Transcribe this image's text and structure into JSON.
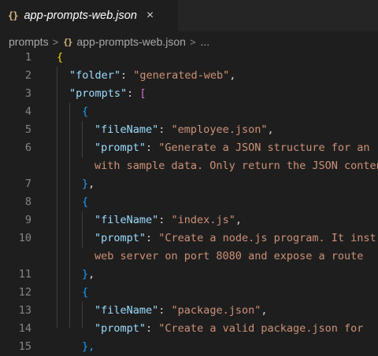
{
  "tab": {
    "icon": "{}",
    "title": "app-prompts-web.json",
    "close": "×"
  },
  "breadcrumb": {
    "folder": "prompts",
    "separator": ">",
    "file_icon": "{}",
    "file": "app-prompts-web.json",
    "more": "..."
  },
  "code": {
    "lines": [
      {
        "n": "1",
        "parts": [
          [
            "b1",
            "{"
          ]
        ]
      },
      {
        "n": "2",
        "parts": [
          [
            "k",
            "\"folder\""
          ],
          [
            "p",
            ": "
          ],
          [
            "s",
            "\"generated-web\""
          ],
          [
            "p",
            ","
          ]
        ]
      },
      {
        "n": "3",
        "parts": [
          [
            "k",
            "\"prompts\""
          ],
          [
            "p",
            ": "
          ],
          [
            "b2",
            "["
          ]
        ]
      },
      {
        "n": "4",
        "parts": [
          [
            "b3",
            "{"
          ]
        ]
      },
      {
        "n": "5",
        "parts": [
          [
            "k",
            "\"fileName\""
          ],
          [
            "p",
            ": "
          ],
          [
            "s",
            "\"employee.json\""
          ],
          [
            "p",
            ","
          ]
        ]
      },
      {
        "n": "6",
        "parts": [
          [
            "k",
            "\"prompt\""
          ],
          [
            "p",
            ": "
          ],
          [
            "s",
            "\"Generate a JSON structure for an"
          ]
        ]
      },
      {
        "n": "",
        "parts": [
          [
            "s",
            "with sample data. Only return the JSON content"
          ]
        ]
      },
      {
        "n": "7",
        "parts": [
          [
            "b3",
            "}"
          ],
          [
            "p",
            ","
          ]
        ]
      },
      {
        "n": "8",
        "parts": [
          [
            "b3",
            "{"
          ]
        ]
      },
      {
        "n": "9",
        "parts": [
          [
            "k",
            "\"fileName\""
          ],
          [
            "p",
            ": "
          ],
          [
            "s",
            "\"index.js\""
          ],
          [
            "p",
            ","
          ]
        ]
      },
      {
        "n": "10",
        "parts": [
          [
            "k",
            "\"prompt\""
          ],
          [
            "p",
            ": "
          ],
          [
            "s",
            "\"Create a node.js program. It inst"
          ]
        ]
      },
      {
        "n": "",
        "parts": [
          [
            "s",
            "web server on port 8080 and expose a route"
          ]
        ]
      },
      {
        "n": "11",
        "parts": [
          [
            "b3",
            "}"
          ],
          [
            "p",
            ","
          ]
        ]
      },
      {
        "n": "12",
        "parts": [
          [
            "b3",
            "{"
          ]
        ]
      },
      {
        "n": "13",
        "parts": [
          [
            "k",
            "\"fileName\""
          ],
          [
            "p",
            ": "
          ],
          [
            "s",
            "\"package.json\""
          ],
          [
            "p",
            ","
          ]
        ]
      },
      {
        "n": "14",
        "parts": [
          [
            "k",
            "\"prompt\""
          ],
          [
            "p",
            ": "
          ],
          [
            "s",
            "\"Create a valid package.json for"
          ]
        ]
      },
      {
        "n": "15",
        "parts": [
          [
            "b3",
            "},"
          ]
        ]
      }
    ]
  }
}
